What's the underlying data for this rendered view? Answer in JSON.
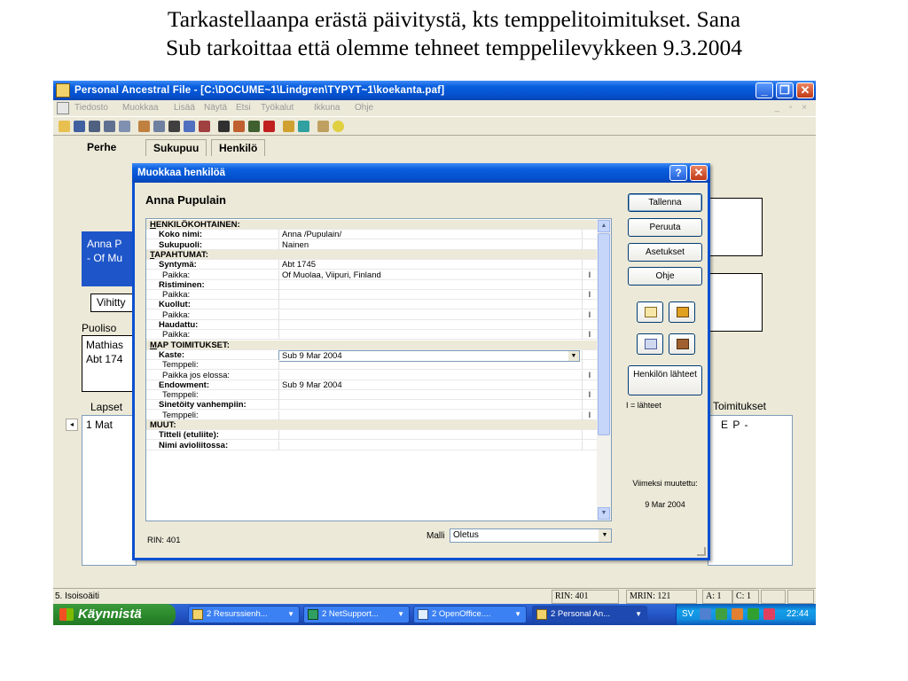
{
  "caption": {
    "line1": "Tarkastellaanpa erästä päivitystä, kts temppelitoimitukset. Sana",
    "line2": "Sub tarkoittaa että olemme tehneet temppelilevykkeen 9.3.2004"
  },
  "window": {
    "title": "Personal Ancestral File - [C:\\DOCUME~1\\Lindgren\\TYPYT~1\\koekanta.paf]",
    "controls": {
      "minimize": "_",
      "maximize": "❐",
      "close": "✕"
    }
  },
  "menu": [
    "Tiedosto",
    "Muokkaa",
    "Lisää",
    "Näytä",
    "Etsi",
    "Työkalut",
    "Ikkuna",
    "Ohje"
  ],
  "mdi_controls": "_ ▫ ×",
  "tabs": [
    "Perhe",
    "Sukupuu",
    "Henkilö"
  ],
  "background": {
    "person_name_line1": "Anna P",
    "person_name_line2": "- Of Mu",
    "vihitty": "Vihitty",
    "puoliso_label": "Puoliso",
    "spouse_line1": "Mathias",
    "spouse_line2": "Abt 174",
    "lapset_label": "Lapset",
    "child_row": "1   Mat",
    "toimitukset_label": "Toimitukset",
    "toimitukset_value": "E  P  -"
  },
  "dialog": {
    "title": "Muokkaa henkilöä",
    "help_button": "?",
    "close_button": "✕",
    "person_name": "Anna Pupulain",
    "rows": [
      {
        "type": "section",
        "label": "HENKILÖKOHTAINEN:"
      },
      {
        "type": "field",
        "label": "Koko nimi:",
        "value": "Anna /Pupulain/",
        "flag": ""
      },
      {
        "type": "field",
        "label": "Sukupuoli:",
        "value": "Nainen",
        "flag": ""
      },
      {
        "type": "section",
        "label": "TAPAHTUMAT:"
      },
      {
        "type": "field",
        "label": "Syntymä:",
        "value": "Abt 1745",
        "flag": ""
      },
      {
        "type": "sub",
        "label": "Paikka:",
        "value": "Of Muolaa, Viipuri, Finland",
        "flag": "I"
      },
      {
        "type": "field",
        "label": "Ristiminen:",
        "value": "",
        "flag": ""
      },
      {
        "type": "sub",
        "label": "Paikka:",
        "value": "",
        "flag": "I"
      },
      {
        "type": "field",
        "label": "Kuollut:",
        "value": "",
        "flag": ""
      },
      {
        "type": "sub",
        "label": "Paikka:",
        "value": "",
        "flag": "I"
      },
      {
        "type": "field",
        "label": "Haudattu:",
        "value": "",
        "flag": ""
      },
      {
        "type": "sub",
        "label": "Paikka:",
        "value": "",
        "flag": "I"
      },
      {
        "type": "section",
        "label": "MAP TOIMITUKSET:"
      },
      {
        "type": "combo",
        "label": "Kaste:",
        "value": "Sub 9 Mar 2004",
        "flag": ""
      },
      {
        "type": "sub",
        "label": "Temppeli:",
        "value": "",
        "flag": ""
      },
      {
        "type": "sub",
        "label": "Paikka jos elossa:",
        "value": "",
        "flag": "I"
      },
      {
        "type": "field",
        "label": "Endowment:",
        "value": "Sub 9 Mar 2004",
        "flag": ""
      },
      {
        "type": "sub",
        "label": "Temppeli:",
        "value": "",
        "flag": "I"
      },
      {
        "type": "field",
        "label": "Sinetöity vanhempiin:",
        "value": "",
        "flag": ""
      },
      {
        "type": "sub",
        "label": "Temppeli:",
        "value": "",
        "flag": "I"
      },
      {
        "type": "section",
        "label": "MUUT:"
      },
      {
        "type": "field",
        "label": "Titteli (etuliite):",
        "value": "",
        "flag": ""
      },
      {
        "type": "field",
        "label": "Nimi avioliitossa:",
        "value": "",
        "flag": ""
      }
    ],
    "buttons": {
      "save": "Tallenna",
      "cancel": "Peruuta",
      "settings": "Asetukset",
      "help": "Ohje",
      "sources": "Henkilön lähteet"
    },
    "sources_note": "I = lähteet",
    "last_modified_label": "Viimeksi muutettu:",
    "last_modified_date": "9 Mar 2004",
    "rin": "RIN: 401",
    "template_label": "Malli",
    "template_value": "Oletus"
  },
  "status": {
    "relation": "5. Isoisoäiti",
    "rin": "RIN: 401",
    "mrin": "MRIN: 121",
    "a": "A: 1",
    "c": "C: 1"
  },
  "taskbar": {
    "start": "Käynnistä",
    "tasks": [
      "2 Resurssienh...",
      "2 NetSupport...",
      "2 OpenOffice....",
      "2 Personal An..."
    ],
    "tray_sv": "SV",
    "clock": "22:44"
  },
  "colors": {
    "xp_blue": "#0a5fde",
    "accent_blue": "#1e55c8",
    "face": "#ece9d8"
  },
  "icons": [
    "app-icon",
    "folder-open-icon",
    "save-icon",
    "edit-icon",
    "print-icon",
    "search-icon",
    "help-icon",
    "scrollbar-up-icon",
    "scrollbar-down-icon",
    "notes-icon",
    "book-icon",
    "pen-icon",
    "scrapbook-icon",
    "start-flag-icon"
  ]
}
